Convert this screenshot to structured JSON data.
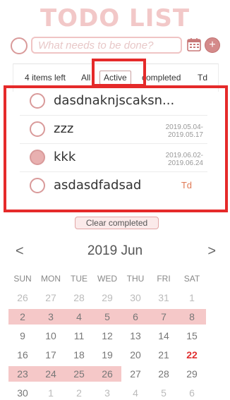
{
  "app": {
    "title": "TODO LIST"
  },
  "input": {
    "placeholder": "What needs to be done?",
    "add_icon": "plus-icon",
    "calendar_icon": "calendar-icon"
  },
  "filters": {
    "count_label": "4 items left",
    "all": "All",
    "active": "Active",
    "completed": "completed",
    "td": "Td"
  },
  "todos": [
    {
      "text": "dasdnaknjscaksn...",
      "done": false,
      "dates": [
        "",
        ""
      ],
      "td": ""
    },
    {
      "text": "zzz",
      "done": false,
      "dates": [
        "2019.05.04-",
        "2019.05.17"
      ],
      "td": ""
    },
    {
      "text": "kkk",
      "done": true,
      "dates": [
        "2019.06.02-",
        "2019.06.24"
      ],
      "td": ""
    },
    {
      "text": "asdasdfadsad",
      "done": false,
      "dates": [
        "",
        ""
      ],
      "td": "Td"
    }
  ],
  "clear_label": "Clear completed",
  "calendar": {
    "prev": "<",
    "next": ">",
    "title": "2019 Jun",
    "weekdays": [
      "SUN",
      "MON",
      "TUE",
      "WED",
      "THU",
      "FRI",
      "SAT"
    ],
    "rows": [
      [
        "26",
        "27",
        "28",
        "29",
        "30",
        "31",
        "1"
      ],
      [
        "2",
        "3",
        "4",
        "5",
        "6",
        "7",
        "8"
      ],
      [
        "9",
        "10",
        "11",
        "12",
        "13",
        "14",
        "15"
      ],
      [
        "16",
        "17",
        "18",
        "19",
        "20",
        "21",
        "22"
      ],
      [
        "23",
        "24",
        "25",
        "26",
        "27",
        "28",
        "29"
      ],
      [
        "30",
        "1",
        "2",
        "3",
        "4",
        "5",
        "6"
      ]
    ],
    "today": "22",
    "accent": "#f5c8c8",
    "today_color": "#e03030"
  }
}
